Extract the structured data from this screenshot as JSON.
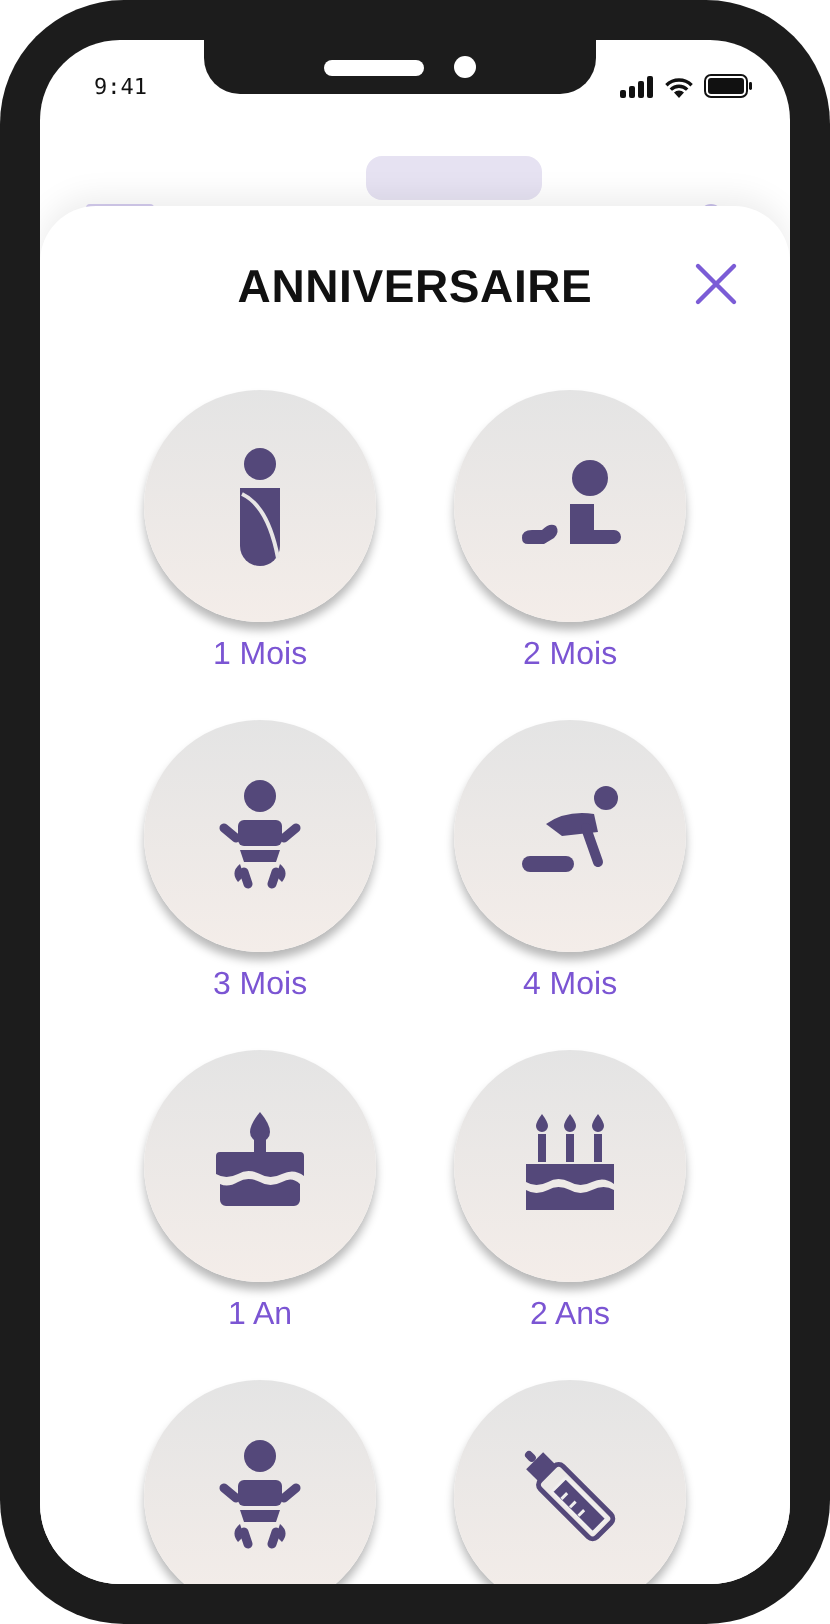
{
  "status_bar": {
    "time": "9:41"
  },
  "sheet": {
    "title": "ANNIVERSAIRE",
    "items": [
      {
        "kind": "swaddle",
        "label": "1 Mois"
      },
      {
        "kind": "crawl",
        "label": "2 Mois"
      },
      {
        "kind": "baby",
        "label": "3 Mois"
      },
      {
        "kind": "kneel",
        "label": "4 Mois"
      },
      {
        "kind": "cake1",
        "label": "1 An"
      },
      {
        "kind": "cake3",
        "label": "2 Ans"
      },
      {
        "kind": "baby"
      },
      {
        "kind": "bottle"
      }
    ]
  }
}
